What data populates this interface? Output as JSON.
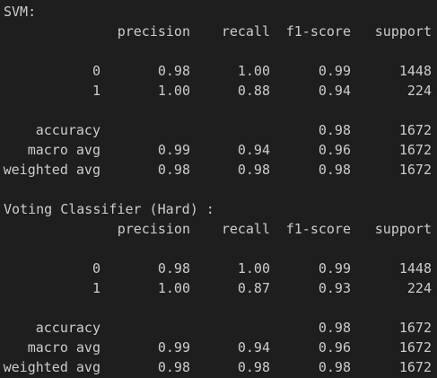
{
  "reports": [
    {
      "title": "SVM:",
      "headers": [
        "precision",
        "recall",
        "f1-score",
        "support"
      ],
      "rows": [
        {
          "label": "0",
          "precision": "0.98",
          "recall": "1.00",
          "f1": "0.99",
          "support": "1448"
        },
        {
          "label": "1",
          "precision": "1.00",
          "recall": "0.88",
          "f1": "0.94",
          "support": "224"
        },
        {
          "label": "accuracy",
          "precision": "",
          "recall": "",
          "f1": "0.98",
          "support": "1672"
        },
        {
          "label": "macro avg",
          "precision": "0.99",
          "recall": "0.94",
          "f1": "0.96",
          "support": "1672"
        },
        {
          "label": "weighted avg",
          "precision": "0.98",
          "recall": "0.98",
          "f1": "0.98",
          "support": "1672"
        }
      ]
    },
    {
      "title": "Voting Classifier (Hard) :",
      "headers": [
        "precision",
        "recall",
        "f1-score",
        "support"
      ],
      "rows": [
        {
          "label": "0",
          "precision": "0.98",
          "recall": "1.00",
          "f1": "0.99",
          "support": "1448"
        },
        {
          "label": "1",
          "precision": "1.00",
          "recall": "0.87",
          "f1": "0.93",
          "support": "224"
        },
        {
          "label": "accuracy",
          "precision": "",
          "recall": "",
          "f1": "0.98",
          "support": "1672"
        },
        {
          "label": "macro avg",
          "precision": "0.99",
          "recall": "0.94",
          "f1": "0.96",
          "support": "1672"
        },
        {
          "label": "weighted avg",
          "precision": "0.98",
          "recall": "0.98",
          "f1": "0.98",
          "support": "1672"
        }
      ]
    }
  ]
}
